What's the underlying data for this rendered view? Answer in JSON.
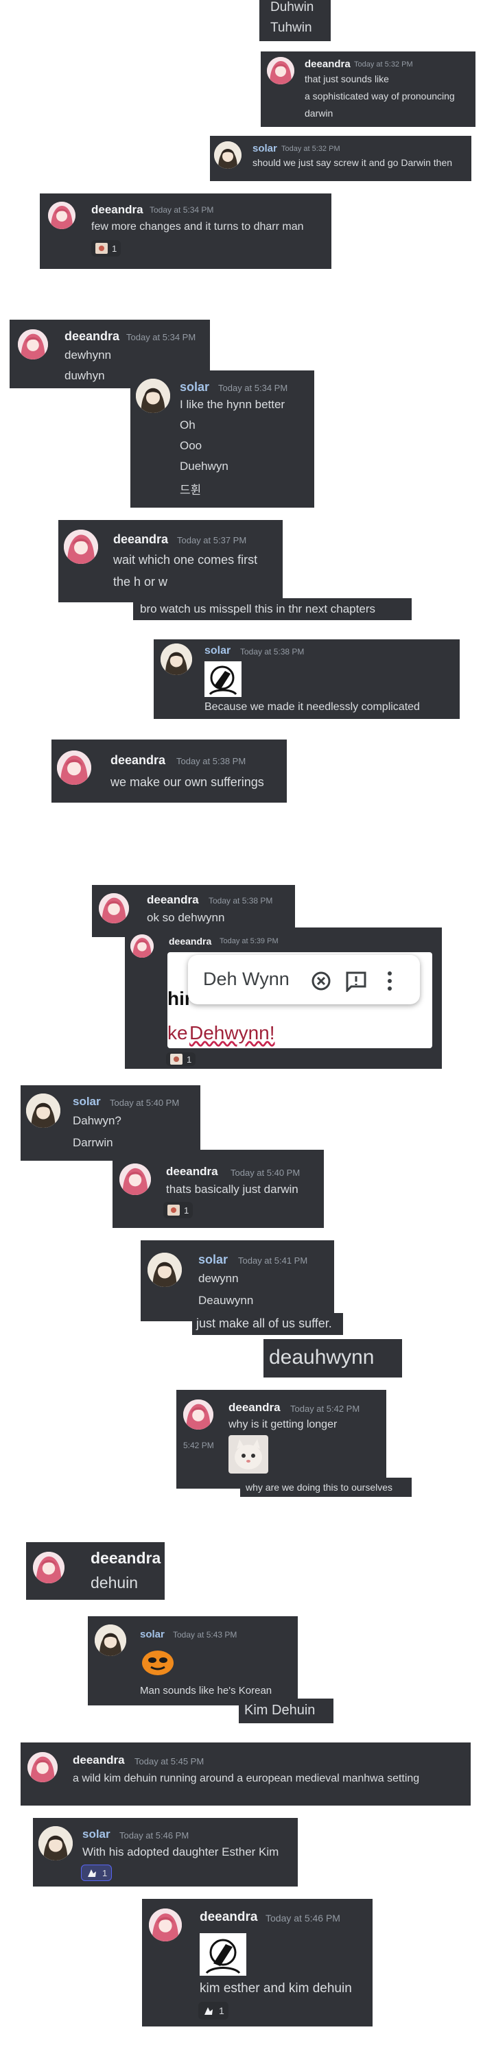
{
  "names": {
    "deeandra": "deeandra",
    "solar": "solar"
  },
  "b01": {
    "l1": "Duhwin",
    "l2": "Tuhwin"
  },
  "b02": {
    "time": "Today at 5:32 PM",
    "l1": "that just sounds like",
    "l2": "a sophisticated way of pronouncing",
    "l3": "darwin"
  },
  "b03": {
    "time": "Today at 5:32 PM",
    "l1": "should we just say screw it and go Darwin then"
  },
  "b04": {
    "time": "Today at 5:34 PM",
    "l1": "few more changes and it turns to dharr man",
    "react": "1"
  },
  "b05": {
    "time": "Today at 5:34 PM",
    "l1": "dewhynn",
    "l2": "duwhyn"
  },
  "b06": {
    "time": "Today at 5:34 PM",
    "l1": "I like the hynn better",
    "l2": "Oh",
    "l3": "Ooo",
    "l4": "Duehwyn",
    "l5": "드휜"
  },
  "b07": {
    "time": "Today at 5:37 PM",
    "l1": "wait which one comes first",
    "l2": "the h or w"
  },
  "b08": {
    "l1": "bro watch us misspell this in thr next chapters"
  },
  "b09": {
    "time": "Today at 5:38 PM",
    "l1": "Because we made it needlessly complicated"
  },
  "b10": {
    "time": "Today at 5:38 PM",
    "l1": "we make our own sufferings"
  },
  "b11": {
    "time": "Today at 5:38 PM",
    "l1": "ok so dehwynn"
  },
  "b12": {
    "time": "Today at 5:39 PM",
    "partial1": "hir",
    "partial2": "ke ",
    "word": "Dehwynn!",
    "suggestion": "Deh Wynn",
    "react": "1"
  },
  "b13": {
    "time": "Today at 5:40 PM",
    "l1": "Dahwyn?",
    "l2": "Darrwin"
  },
  "b14": {
    "time": "Today at 5:40 PM",
    "l1": "thats basically just darwin",
    "react": "1"
  },
  "b15": {
    "time": "Today at 5:41 PM",
    "l1": "dewynn",
    "l2": "Deauwynn",
    "l3": "just make all of us suffer."
  },
  "b16": {
    "l1": "deauhwynn"
  },
  "b17": {
    "time": "Today at 5:42 PM",
    "side_time": "5:42 PM",
    "l1": "why is it getting longer",
    "l2": "why are we doing this to ourselves"
  },
  "b18": {
    "l1": "dehuin"
  },
  "b19": {
    "time": "Today at 5:43 PM",
    "l1": "Man sounds like he's Korean",
    "l2": "Kim Dehuin"
  },
  "b20": {
    "time": "Today at 5:45 PM",
    "l1": "a wild kim dehuin running around a european medieval manhwa setting"
  },
  "b21": {
    "time": "Today at 5:46 PM",
    "l1": "With his adopted daughter Esther Kim",
    "react": "1"
  },
  "b22": {
    "time": "Today at 5:46 PM",
    "l1": "kim esther and kim dehuin",
    "react": "1"
  },
  "colors": {
    "card": "#313338",
    "username_deeandra": "#f2f3f5",
    "username_solar": "#a4c3e8",
    "timestamp": "#949ba4",
    "misspell_underline": "#c7254e"
  }
}
